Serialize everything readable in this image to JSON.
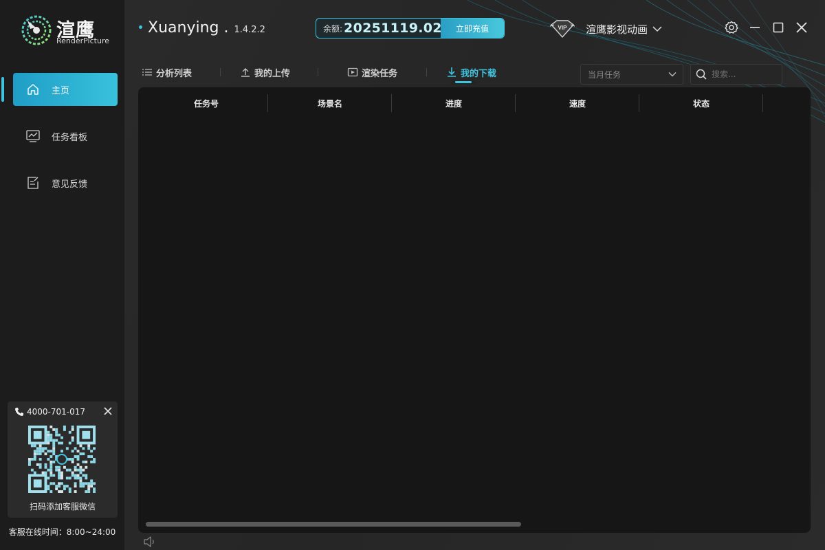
{
  "brand": {
    "logo_cn": "渲鹰",
    "logo_en": "RenderPicture",
    "accent_color": "#3fc3de"
  },
  "title_bar": {
    "app_name": "Xuanying .",
    "version": "1.4.2.2",
    "balance_label": "余额:",
    "balance_value": "20251119.02",
    "recharge_label": "立即充值",
    "account_name": "渲鹰影视动画",
    "icons": [
      "vip-icon",
      "chevron-down-icon",
      "gear-icon",
      "minimize-icon",
      "maximize-icon",
      "close-icon"
    ]
  },
  "sidebar": {
    "items": [
      {
        "label": "主页",
        "icon": "home-icon",
        "active": true
      },
      {
        "label": "任务看板",
        "icon": "chart-board-icon",
        "active": false
      },
      {
        "label": "意见反馈",
        "icon": "feedback-icon",
        "active": false
      }
    ],
    "support": {
      "phone": "4000-701-017",
      "qr_caption": "扫码添加客服微信",
      "service_hours": "客服在线时间：8:00~24:00"
    }
  },
  "tabs": [
    {
      "label": "分析列表",
      "icon": "list-icon",
      "active": false
    },
    {
      "label": "我的上传",
      "icon": "upload-icon",
      "active": false
    },
    {
      "label": "渲染任务",
      "icon": "render-icon",
      "active": false
    },
    {
      "label": "我的下载",
      "icon": "download-icon",
      "active": true
    }
  ],
  "filters": {
    "period_selected": "当月任务",
    "search_placeholder": "搜索..."
  },
  "table": {
    "columns": [
      "任务号",
      "场景名",
      "进度",
      "速度",
      "状态"
    ],
    "rows": []
  }
}
